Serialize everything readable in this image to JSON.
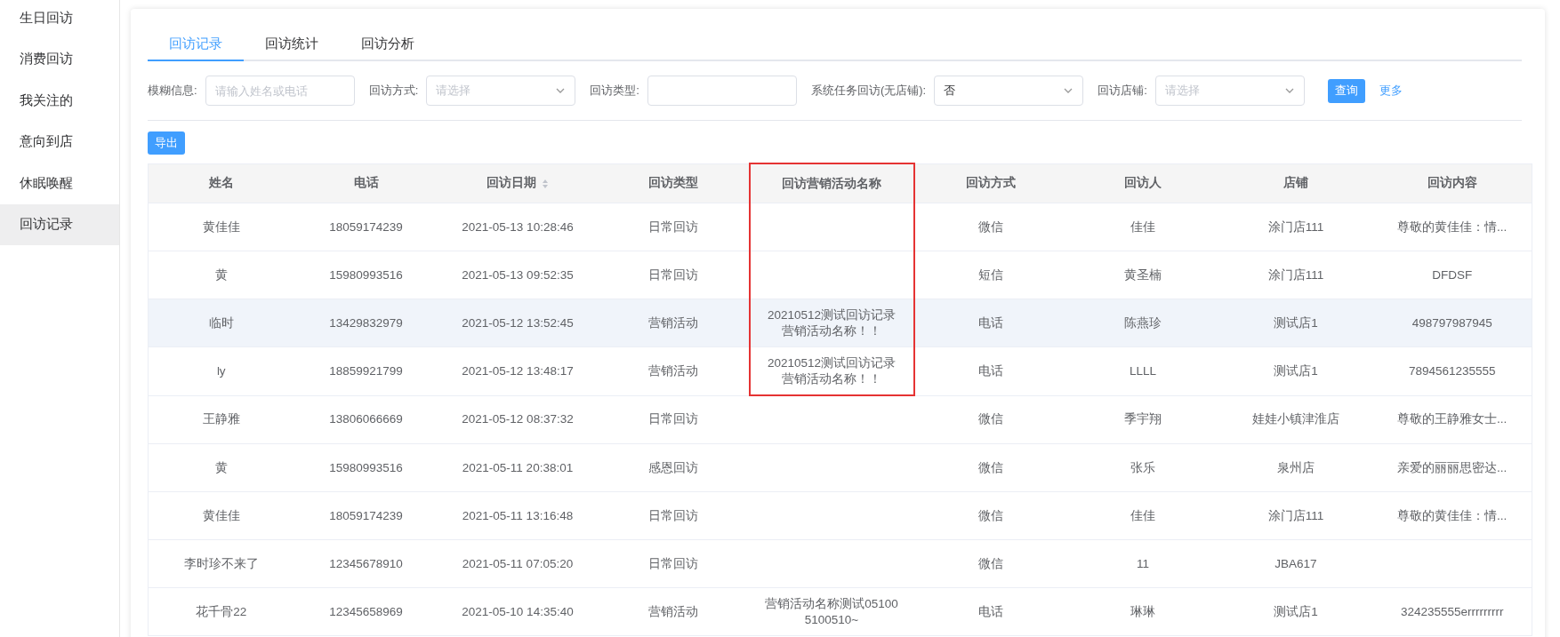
{
  "sidebar": {
    "items": [
      {
        "label": "生日回访",
        "selected": false
      },
      {
        "label": "消费回访",
        "selected": false
      },
      {
        "label": "我关注的",
        "selected": false
      },
      {
        "label": "意向到店",
        "selected": false
      },
      {
        "label": "休眠唤醒",
        "selected": false
      },
      {
        "label": "回访记录",
        "selected": true
      }
    ]
  },
  "tabs": [
    {
      "label": "回访记录",
      "selected": true
    },
    {
      "label": "回访统计",
      "selected": false
    },
    {
      "label": "回访分析",
      "selected": false
    }
  ],
  "filters": [
    {
      "kind": "input",
      "label": "模糊信息:",
      "placeholder": "请输入姓名或电话"
    },
    {
      "kind": "select",
      "label": "回访方式:",
      "placeholder": "请选择"
    },
    {
      "kind": "input",
      "label": "回访类型:"
    },
    {
      "kind": "select",
      "label": "系统任务回访(无店铺):",
      "value": "否"
    },
    {
      "kind": "select",
      "label": "回访店铺:",
      "placeholder": "请选择"
    }
  ],
  "query_button": "查询",
  "more_link": "更多",
  "export_button": "导出",
  "table": {
    "columns": [
      {
        "label": "姓名",
        "sortable": false,
        "highlighted": false
      },
      {
        "label": "电话",
        "sortable": false,
        "highlighted": false
      },
      {
        "label": "回访日期",
        "sortable": true,
        "highlighted": false
      },
      {
        "label": "回访类型",
        "sortable": false,
        "highlighted": false
      },
      {
        "label": "回访营销活动名称",
        "sortable": false,
        "highlighted": true
      },
      {
        "label": "回访方式",
        "sortable": false,
        "highlighted": false
      },
      {
        "label": "回访人",
        "sortable": false,
        "highlighted": false
      },
      {
        "label": "店铺",
        "sortable": false,
        "highlighted": false
      },
      {
        "label": "回访内容",
        "sortable": false,
        "highlighted": false
      }
    ],
    "rows": [
      {
        "hovered": false,
        "highlighted": true,
        "cells": [
          "黄佳佳",
          "18059174239",
          "2021-05-13 10:28:46",
          "日常回访",
          "",
          "微信",
          "佳佳",
          "涂门店111",
          "尊敬的黄佳佳：情..."
        ]
      },
      {
        "hovered": false,
        "highlighted": true,
        "cells": [
          "黄",
          "15980993516",
          "2021-05-13 09:52:35",
          "日常回访",
          "",
          "短信",
          "黄圣楠",
          "涂门店111",
          "DFDSF"
        ]
      },
      {
        "hovered": true,
        "highlighted": true,
        "cells": [
          "临时",
          "13429832979",
          "2021-05-12 13:52:45",
          "营销活动",
          "20210512测试回访记录营销活动名称！！",
          "电话",
          "陈燕珍",
          "测试店1",
          "498797987945"
        ]
      },
      {
        "hovered": false,
        "highlighted": true,
        "cells": [
          "ly",
          "18859921799",
          "2021-05-12 13:48:17",
          "营销活动",
          "20210512测试回访记录营销活动名称！！",
          "电话",
          "LLLL",
          "测试店1",
          "7894561235555"
        ]
      },
      {
        "hovered": false,
        "highlighted": false,
        "cells": [
          "王静雅",
          "13806066669",
          "2021-05-12 08:37:32",
          "日常回访",
          "",
          "微信",
          "季宇翔",
          "娃娃小镇津淮店",
          "尊敬的王静雅女士..."
        ]
      },
      {
        "hovered": false,
        "highlighted": false,
        "cells": [
          "黄",
          "15980993516",
          "2021-05-11 20:38:01",
          "感恩回访",
          "",
          "微信",
          "张乐",
          "泉州店",
          "亲爱的丽丽思密达..."
        ]
      },
      {
        "hovered": false,
        "highlighted": false,
        "cells": [
          "黄佳佳",
          "18059174239",
          "2021-05-11 13:16:48",
          "日常回访",
          "",
          "微信",
          "佳佳",
          "涂门店111",
          "尊敬的黄佳佳：情..."
        ]
      },
      {
        "hovered": false,
        "highlighted": false,
        "cells": [
          "李时珍不来了",
          "12345678910",
          "2021-05-11 07:05:20",
          "日常回访",
          "",
          "微信",
          "11",
          "JBA617",
          ""
        ]
      },
      {
        "hovered": false,
        "highlighted": false,
        "cells": [
          "花千骨22",
          "12345658969",
          "2021-05-10 14:35:40",
          "营销活动",
          "营销活动名称测试051005100510~",
          "电话",
          "琳琳",
          "测试店1",
          "324235555errrrrrrrr"
        ]
      }
    ]
  }
}
